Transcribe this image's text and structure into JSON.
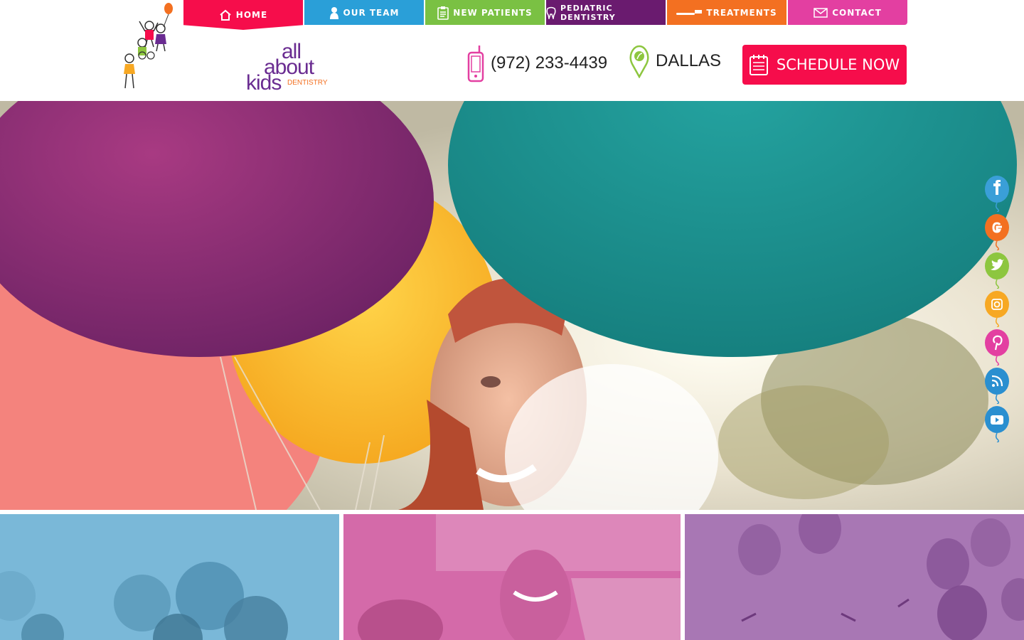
{
  "brand": {
    "logo_lines": [
      "all",
      "about",
      "kids",
      "DENTISTRY"
    ]
  },
  "nav": [
    {
      "label": "HOME",
      "icon": "home-icon",
      "color": "#f60d4b"
    },
    {
      "label": "OUR TEAM",
      "icon": "person-icon",
      "color": "#2a9fd8"
    },
    {
      "label": "NEW PATIENTS",
      "icon": "clipboard-icon",
      "color": "#7ac143"
    },
    {
      "label": "PEDIATRIC DENTISTRY",
      "icon": "tooth-icon",
      "color": "#6a1b6f"
    },
    {
      "label": "TREATMENTS",
      "icon": "toothbrush-icon",
      "color": "#f37021"
    },
    {
      "label": "CONTACT",
      "icon": "envelope-icon",
      "color": "#e33fa1"
    }
  ],
  "header": {
    "phone": "(972) 233-4439",
    "location": "DALLAS",
    "schedule_label": "SCHEDULE NOW",
    "schedule_color": "#f60d4b"
  },
  "social": [
    {
      "icon": "facebook-icon",
      "color": "#3a9fd8"
    },
    {
      "icon": "google-icon",
      "color": "#f37021"
    },
    {
      "icon": "twitter-icon",
      "color": "#8dc63f"
    },
    {
      "icon": "instagram-icon",
      "color": "#f7a823"
    },
    {
      "icon": "pinterest-icon",
      "color": "#e33fa1"
    },
    {
      "icon": "rss-icon",
      "color": "#2a8fd0"
    },
    {
      "icon": "youtube-icon",
      "color": "#2a8fd0"
    }
  ],
  "tiles": [
    {
      "tint": "#7ab8d8"
    },
    {
      "tint": "#d46aa9"
    },
    {
      "tint": "#a877b4"
    }
  ]
}
